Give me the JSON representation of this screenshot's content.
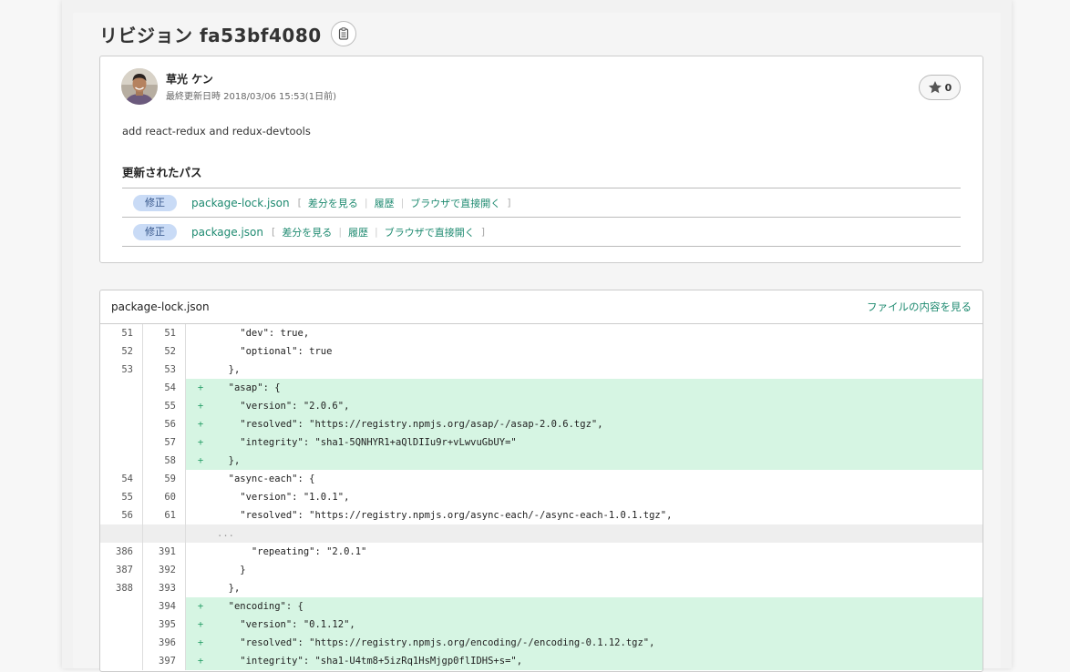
{
  "revision": {
    "title": "リビジョン fa53bf4080"
  },
  "author": {
    "name": "草光 ケン",
    "meta": "最終更新日時 2018/03/06 15:53(1日前)"
  },
  "star": {
    "count": "0"
  },
  "commit_message": "add react-redux and redux-devtools",
  "paths_section": {
    "title": "更新されたパス",
    "items": [
      {
        "badge": "修正",
        "name": "package-lock.json",
        "open": "[",
        "close": "]",
        "links": [
          "差分を見る",
          "履歴",
          "ブラウザで直接開く"
        ]
      },
      {
        "badge": "修正",
        "name": "package.json",
        "open": "[",
        "close": "]",
        "links": [
          "差分を見る",
          "履歴",
          "ブラウザで直接開く"
        ]
      }
    ]
  },
  "diff": {
    "file": "package-lock.json",
    "view_link": "ファイルの内容を見る",
    "rows": [
      {
        "type": "ctx",
        "old": "51",
        "new": "51",
        "mark": "",
        "code": "    \"dev\": true,"
      },
      {
        "type": "ctx",
        "old": "52",
        "new": "52",
        "mark": "",
        "code": "    \"optional\": true"
      },
      {
        "type": "ctx",
        "old": "53",
        "new": "53",
        "mark": "",
        "code": "  },"
      },
      {
        "type": "add",
        "old": "",
        "new": "54",
        "mark": "+",
        "code": "  \"asap\": {"
      },
      {
        "type": "add",
        "old": "",
        "new": "55",
        "mark": "+",
        "code": "    \"version\": \"2.0.6\","
      },
      {
        "type": "add",
        "old": "",
        "new": "56",
        "mark": "+",
        "code": "    \"resolved\": \"https://registry.npmjs.org/asap/-/asap-2.0.6.tgz\","
      },
      {
        "type": "add",
        "old": "",
        "new": "57",
        "mark": "+",
        "code": "    \"integrity\": \"sha1-5QNHYR1+aQlDIIu9r+vLwvuGbUY=\""
      },
      {
        "type": "add",
        "old": "",
        "new": "58",
        "mark": "+",
        "code": "  },"
      },
      {
        "type": "ctx",
        "old": "54",
        "new": "59",
        "mark": "",
        "code": "  \"async-each\": {"
      },
      {
        "type": "ctx",
        "old": "55",
        "new": "60",
        "mark": "",
        "code": "    \"version\": \"1.0.1\","
      },
      {
        "type": "ctx",
        "old": "56",
        "new": "61",
        "mark": "",
        "code": "    \"resolved\": \"https://registry.npmjs.org/async-each/-/async-each-1.0.1.tgz\","
      },
      {
        "type": "gap",
        "old": "",
        "new": "",
        "mark": "",
        "code": "..."
      },
      {
        "type": "ctx",
        "old": "386",
        "new": "391",
        "mark": "",
        "code": "      \"repeating\": \"2.0.1\""
      },
      {
        "type": "ctx",
        "old": "387",
        "new": "392",
        "mark": "",
        "code": "    }"
      },
      {
        "type": "ctx",
        "old": "388",
        "new": "393",
        "mark": "",
        "code": "  },"
      },
      {
        "type": "add",
        "old": "",
        "new": "394",
        "mark": "+",
        "code": "  \"encoding\": {"
      },
      {
        "type": "add",
        "old": "",
        "new": "395",
        "mark": "+",
        "code": "    \"version\": \"0.1.12\","
      },
      {
        "type": "add",
        "old": "",
        "new": "396",
        "mark": "+",
        "code": "    \"resolved\": \"https://registry.npmjs.org/encoding/-/encoding-0.1.12.tgz\","
      },
      {
        "type": "add",
        "old": "",
        "new": "397",
        "mark": "+",
        "code": "    \"integrity\": \"sha1-U4tm8+5izRq1HsMjgp0flIDHS+s=\","
      }
    ]
  },
  "colors": {
    "link": "#1e8a70",
    "added_bg": "#d6f5e3",
    "badge_bg": "#c9dbf6"
  }
}
